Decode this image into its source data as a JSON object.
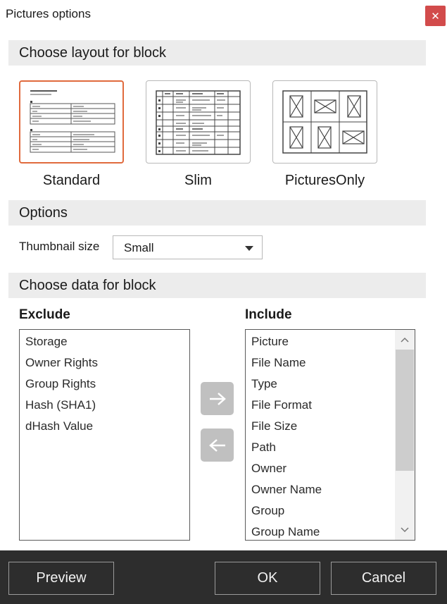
{
  "window": {
    "title": "Pictures options",
    "close_icon": "close-icon"
  },
  "sections": {
    "layout": "Choose layout for block",
    "options": "Options",
    "data": "Choose data for block"
  },
  "layouts": [
    {
      "label": "Standard",
      "selected": true
    },
    {
      "label": "Slim",
      "selected": false
    },
    {
      "label": "PicturesOnly",
      "selected": false
    }
  ],
  "options": {
    "thumbnail_label": "Thumbnail size",
    "thumbnail_value": "Small"
  },
  "exclude": {
    "header": "Exclude",
    "items": [
      "Storage",
      "Owner Rights",
      "Group Rights",
      "Hash (SHA1)",
      "dHash Value"
    ]
  },
  "include": {
    "header": "Include",
    "items": [
      "Picture",
      "File Name",
      "Type",
      "File Format",
      "File Size",
      "Path",
      "Owner",
      "Owner Name",
      "Group",
      "Group Name"
    ]
  },
  "footer": {
    "preview": "Preview",
    "ok": "OK",
    "cancel": "Cancel"
  },
  "colors": {
    "accent_selected": "#e06a3d",
    "close_bg": "#d24b4b",
    "footer_bg": "#2d2d2d",
    "section_bg": "#ececec"
  }
}
